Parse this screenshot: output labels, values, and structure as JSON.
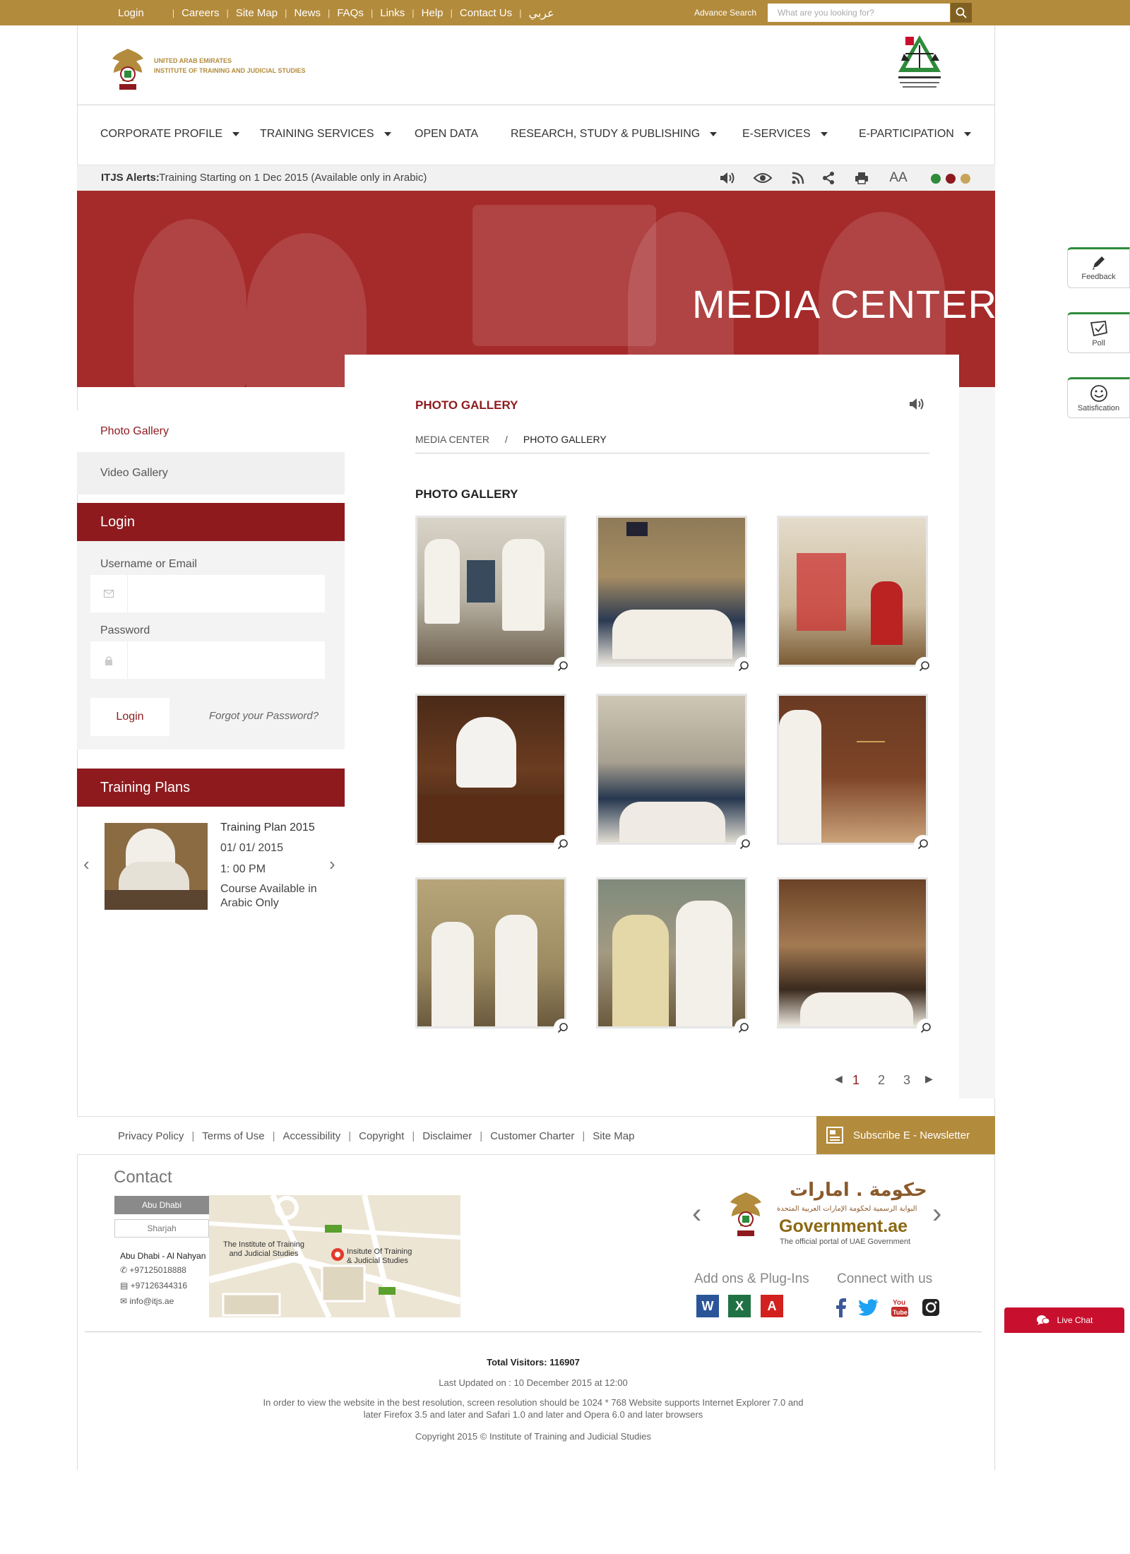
{
  "topbar": {
    "items": [
      "Login",
      "Careers",
      "Site Map",
      "News",
      "FAQs",
      "Links",
      "Help",
      "Contact Us",
      "عربي"
    ],
    "advance_search": "Advance Search",
    "search_placeholder": "What are you looking for?"
  },
  "header": {
    "logo_line1": "UNITED ARAB EMIRATES",
    "logo_line2": "INSTITUTE OF TRAINING AND JUDICIAL STUDIES"
  },
  "nav": {
    "items": [
      "CORPORATE PROFILE",
      "TRAINING SERVICES",
      "OPEN DATA",
      "RESEARCH, STUDY & PUBLISHING",
      "E-SERVICES",
      "E-PARTICIPATION"
    ]
  },
  "alert": {
    "title": "ITJS Alerts:",
    "text": "Training Starting on 1 Dec 2015 (Available only in Arabic)",
    "font_size_label": "AA",
    "theme_colors": [
      "#2e8b3a",
      "#8e1a1e",
      "#c8a45a"
    ]
  },
  "hero": {
    "title": "MEDIA CENTER"
  },
  "sidebar": {
    "items": [
      "Photo Gallery",
      "Video Gallery"
    ],
    "login": {
      "title": "Login",
      "username_label": "Username or Email",
      "password_label": "Password",
      "button": "Login",
      "forgot": "Forgot your Password?"
    },
    "training": {
      "title": "Training Plans",
      "name": "Training Plan 2015",
      "date": "01/ 01/ 2015",
      "time": "1: 00 PM",
      "note_line1": "Course Available in",
      "note_line2": "Arabic Only"
    }
  },
  "content": {
    "section_title": "PHOTO GALLERY",
    "breadcrumb": [
      "MEDIA CENTER",
      "/",
      "PHOTO GALLERY"
    ],
    "gallery_title": "PHOTO GALLERY",
    "pages": [
      "1",
      "2",
      "3"
    ],
    "current_page": "1"
  },
  "footer": {
    "links": [
      "Privacy Policy",
      "Terms of Use",
      "Accessibility",
      "Copyright",
      "Disclaimer",
      "Customer Charter",
      "Site Map"
    ],
    "newsletter": "Subscribe E - Newsletter",
    "contact_title": "Contact",
    "cities": [
      "Abu Dhabi",
      "Sharjah"
    ],
    "address_title": "Abu Dhabi - Al Nahyan",
    "phone": "+97125018888",
    "fax": "+97126344316",
    "email": "info@itjs.ae",
    "map_label1_l1": "The Institute of Training",
    "map_label1_l2": "and Judicial Studies",
    "map_label2_l1": "Insitute Of Training",
    "map_label2_l2": "& Judicial Studies",
    "gov_arabic": "حكومة . امارات",
    "gov_arabic_sub": "البوابة الرسمية لحكومة الإمارات العربية المتحدة",
    "gov_english": "Government.ae",
    "gov_tagline": "The official portal of UAE Government",
    "addons_title": "Add ons & Plug-Ins",
    "connect_title": "Connect with us",
    "visitors": "Total Visitors: 116907",
    "last_updated": "Last Updated on : 10 December 2015 at 12:00",
    "resolution_l1": "In order to view the website in the best resolution, screen resolution should be 1024 * 768 Website supports Internet Explorer 7.0 and",
    "resolution_l2": "later Firefox 3.5 and later and Safari 1.0 and later and Opera 6.0 and later browsers",
    "copyright": "Copyright 2015 © Institute of Training and Judicial Studies"
  },
  "floating": {
    "feedback": "Feedback",
    "poll": "Poll",
    "satisfaction": "Satisfication",
    "live_chat": "Live Chat"
  }
}
